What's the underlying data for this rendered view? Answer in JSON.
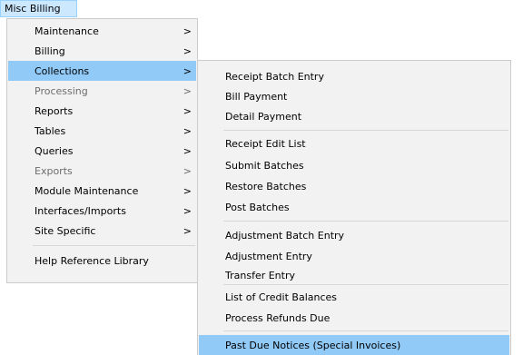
{
  "menubar": {
    "title": "Misc Billing"
  },
  "main_menu": {
    "items": [
      {
        "label": "Maintenance",
        "arrow": ">"
      },
      {
        "label": "Billing",
        "arrow": ">"
      },
      {
        "label": "Collections",
        "arrow": ">"
      },
      {
        "label": "Processing",
        "arrow": ">"
      },
      {
        "label": "Reports",
        "arrow": ">"
      },
      {
        "label": "Tables",
        "arrow": ">"
      },
      {
        "label": "Queries",
        "arrow": ">"
      },
      {
        "label": "Exports",
        "arrow": ">"
      },
      {
        "label": "Module Maintenance",
        "arrow": ">"
      },
      {
        "label": "Interfaces/Imports",
        "arrow": ">"
      },
      {
        "label": "Site Specific",
        "arrow": ">"
      },
      {
        "label": "Help Reference Library"
      }
    ]
  },
  "submenu": {
    "items": [
      {
        "label": "Receipt Batch Entry"
      },
      {
        "label": "Bill Payment"
      },
      {
        "label": "Detail Payment"
      },
      {
        "label": "Receipt Edit List"
      },
      {
        "label": "Submit Batches"
      },
      {
        "label": "Restore Batches"
      },
      {
        "label": "Post Batches"
      },
      {
        "label": "Adjustment Batch Entry"
      },
      {
        "label": "Adjustment Entry"
      },
      {
        "label": "Transfer Entry"
      },
      {
        "label": "List of Credit Balances"
      },
      {
        "label": "Process Refunds Due"
      },
      {
        "label": "Past Due Notices (Special Invoices)"
      }
    ]
  },
  "colors": {
    "menu_background": "#f2f2f2",
    "highlight": "#91c9f7",
    "menubar_highlight": "#cce8ff",
    "disabled_text": "#6d6d6d"
  }
}
